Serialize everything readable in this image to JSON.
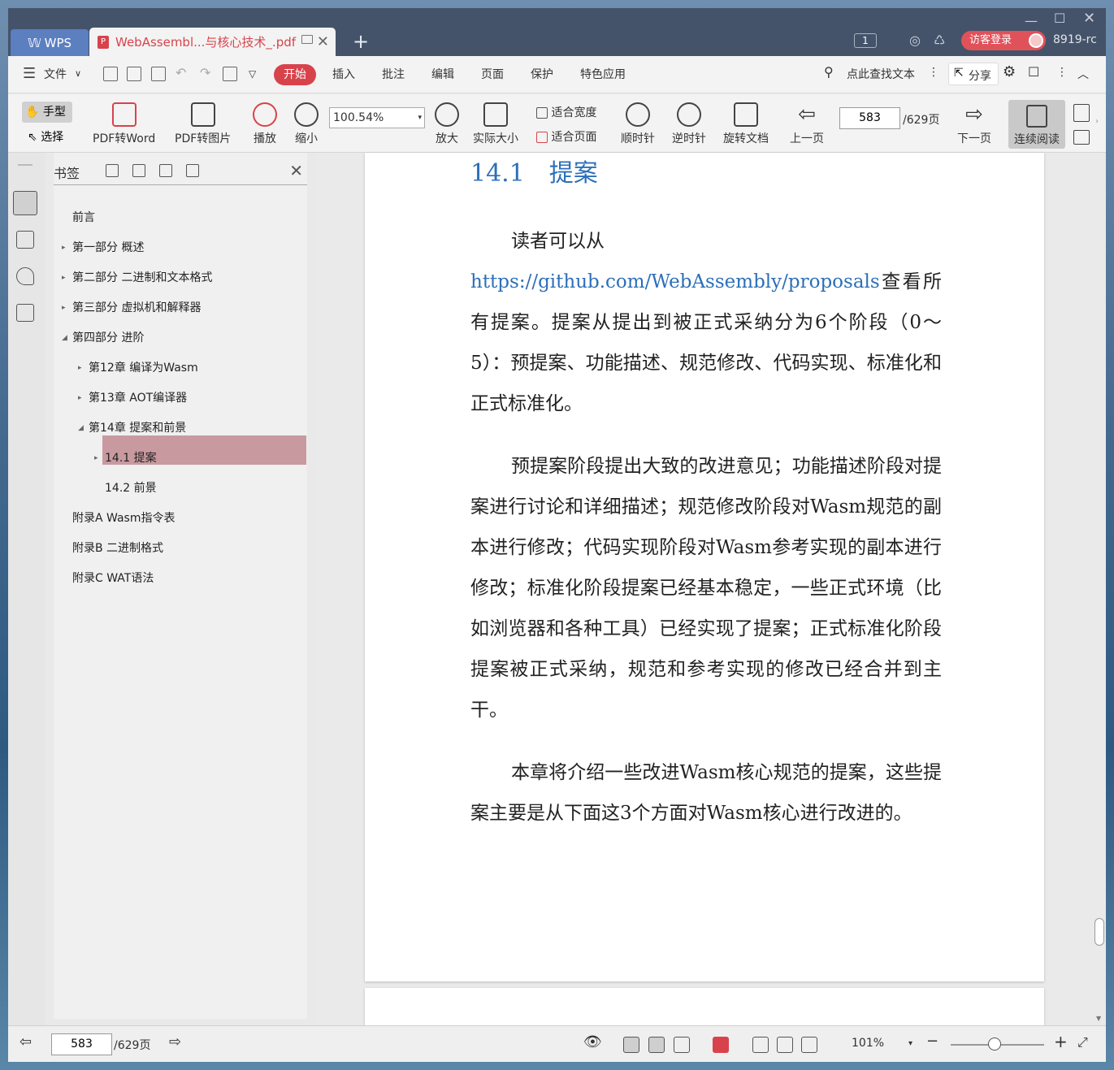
{
  "window": {
    "wps_tab": "WPS",
    "doc_tab_title": "WebAssembl...与核心技术_.pdf",
    "page_badge": "1",
    "login_label": "访客登录",
    "version": "8919-rc"
  },
  "menu": {
    "file": "文件",
    "tabs": [
      "开始",
      "插入",
      "批注",
      "编辑",
      "页面",
      "保护",
      "特色应用"
    ],
    "search": "点此查找文本",
    "share": "分享"
  },
  "toolbar": {
    "hand": "手型",
    "select": "选择",
    "pdf_word": "PDF转Word",
    "pdf_image": "PDF转图片",
    "play": "播放",
    "zoom_out": "缩小",
    "zoom_value": "100.54%",
    "zoom_in": "放大",
    "actual_size": "实际大小",
    "fit_width": "适合宽度",
    "fit_page": "适合页面",
    "clockwise": "顺时针",
    "counter_clockwise": "逆时针",
    "rotate_doc": "旋转文档",
    "prev_page": "上一页",
    "page_value": "583",
    "page_total": "/629页",
    "next_page": "下一页",
    "continuous": "连续阅读"
  },
  "bookmarks": {
    "title": "书签",
    "items": [
      {
        "label": "前言",
        "level": 0,
        "arrow": ""
      },
      {
        "label": "第一部分 概述",
        "level": 0,
        "arrow": "▸"
      },
      {
        "label": "第二部分 二进制和文本格式",
        "level": 0,
        "arrow": "▸"
      },
      {
        "label": "第三部分 虚拟机和解释器",
        "level": 0,
        "arrow": "▸"
      },
      {
        "label": "第四部分 进阶",
        "level": 0,
        "arrow": "◢"
      },
      {
        "label": "第12章 编译为Wasm",
        "level": 1,
        "arrow": "▸"
      },
      {
        "label": "第13章 AOT编译器",
        "level": 1,
        "arrow": "▸"
      },
      {
        "label": "第14章 提案和前景",
        "level": 1,
        "arrow": "◢"
      },
      {
        "label": "14.1 提案",
        "level": 2,
        "arrow": "▸"
      },
      {
        "label": "14.2 前景",
        "level": 2,
        "arrow": ""
      },
      {
        "label": "附录A Wasm指令表",
        "level": 0,
        "arrow": ""
      },
      {
        "label": "附录B 二进制格式",
        "level": 0,
        "arrow": ""
      },
      {
        "label": "附录C WAT语法",
        "level": 0,
        "arrow": ""
      }
    ]
  },
  "content": {
    "heading": "14.1　提案",
    "p1_lead": "读者可以从",
    "p1_link": "https://github.com/WebAssembly/proposals",
    "p1_rest": "查看所有提案。提案从提出到被正式采纳分为6个阶段（0～5）：预提案、功能描述、规范修改、代码实现、标准化和正式标准化。",
    "p2": "预提案阶段提出大致的改进意见；功能描述阶段对提案进行讨论和详细描述；规范修改阶段对Wasm规范的副本进行修改；代码实现阶段对Wasm参考实现的副本进行修改；标准化阶段提案已经基本稳定，一些正式环境（比如浏览器和各种工具）已经实现了提案；正式标准化阶段提案被正式采纳，规范和参考实现的修改已经合并到主干。",
    "p3": "本章将介绍一些改进Wasm核心规范的提案，这些提案主要是从下面这3个方面对Wasm核心进行改进的。"
  },
  "status": {
    "page_value": "583",
    "page_total": "/629页",
    "zoom": "101%"
  }
}
